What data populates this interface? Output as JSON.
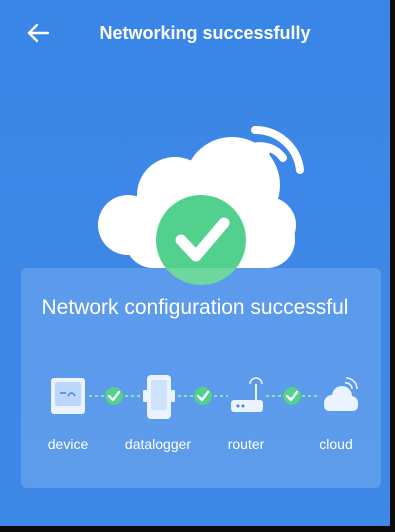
{
  "header": {
    "title": "Networking successfully"
  },
  "status": {
    "message": "Network configuration successful"
  },
  "flow": {
    "steps": [
      "device",
      "datalogger",
      "router",
      "cloud"
    ]
  },
  "colors": {
    "background": "#3a86e6",
    "success_green": "#52d08e",
    "cloud_white": "#ffffff"
  },
  "icons": {
    "back": "back-arrow-icon",
    "hero": "cloud-success-icon",
    "wifi": "wifi-signal-icon",
    "check": "check-icon"
  }
}
